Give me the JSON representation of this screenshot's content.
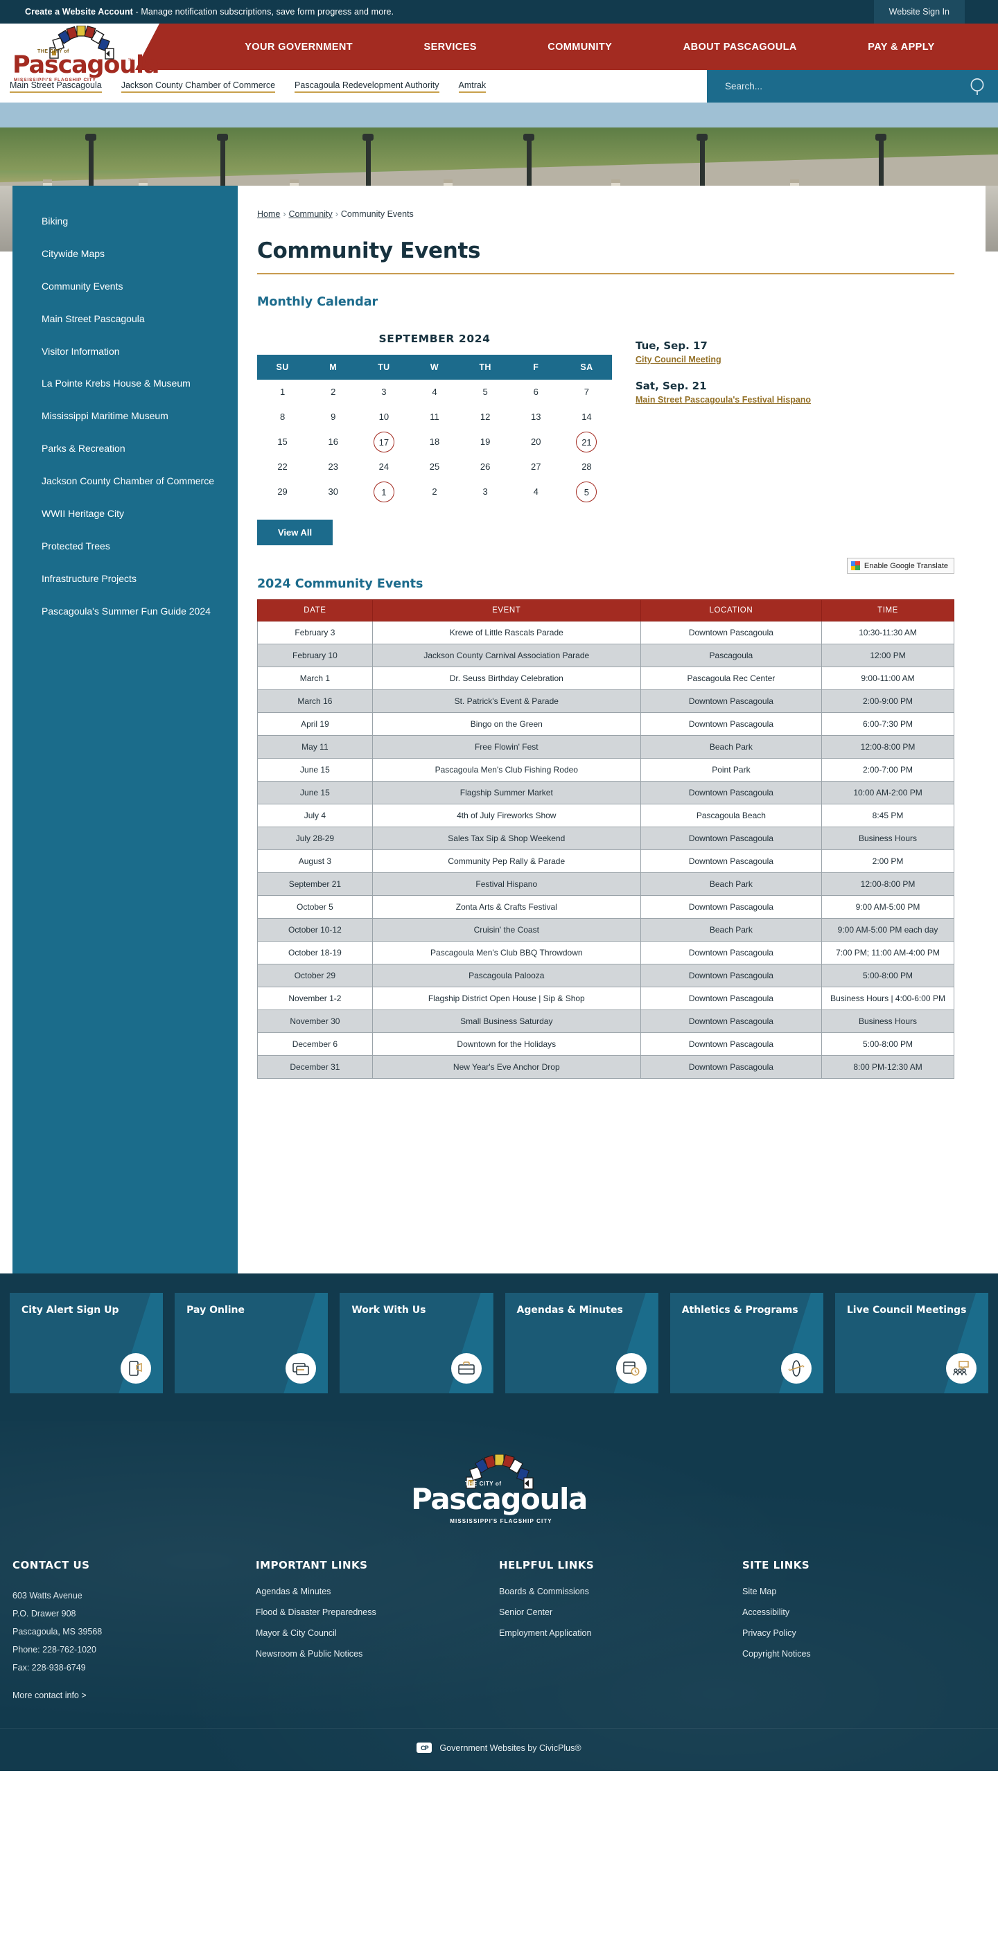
{
  "utility": {
    "account_cta": "Create a Website Account",
    "account_desc": " - Manage notification subscriptions, save form progress and more.",
    "signin_label": "Website Sign In"
  },
  "brand": {
    "name": "Pascagoula",
    "tagline": "THE CITY of",
    "subtitle": "MISSISSIPPI'S FLAGSHIP CITY",
    "tm": "™"
  },
  "main_nav": [
    {
      "label": "YOUR GOVERNMENT"
    },
    {
      "label": "SERVICES"
    },
    {
      "label": "COMMUNITY"
    },
    {
      "label": "ABOUT PASCAGOULA"
    },
    {
      "label": "PAY & APPLY"
    }
  ],
  "sub_nav": [
    {
      "label": "Main Street Pascagoula"
    },
    {
      "label": "Jackson County Chamber of Commerce"
    },
    {
      "label": "Pascagoula Redevelopment Authority"
    },
    {
      "label": "Amtrak"
    }
  ],
  "search": {
    "placeholder": "Search...",
    "value": ""
  },
  "sidebar": {
    "items": [
      {
        "label": "Biking"
      },
      {
        "label": "Citywide Maps"
      },
      {
        "label": "Community Events"
      },
      {
        "label": "Main Street Pascagoula"
      },
      {
        "label": "Visitor Information"
      },
      {
        "label": "La Pointe Krebs House & Museum"
      },
      {
        "label": "Mississippi Maritime Museum"
      },
      {
        "label": "Parks & Recreation"
      },
      {
        "label": "Jackson County Chamber of Commerce"
      },
      {
        "label": "WWII Heritage City"
      },
      {
        "label": "Protected Trees"
      },
      {
        "label": "Infrastructure Projects"
      },
      {
        "label": "Pascagoula's Summer Fun Guide 2024"
      }
    ]
  },
  "breadcrumb": {
    "home": "Home",
    "parent": "Community",
    "current": "Community Events",
    "separator": "›"
  },
  "page": {
    "title": "Community Events",
    "calendar_heading": "Monthly Calendar",
    "events_table_heading": "2024 Community Events",
    "view_all_label": "View All"
  },
  "translate": {
    "label": "Enable Google Translate"
  },
  "calendar": {
    "month_label": "SEPTEMBER 2024",
    "weekdays": [
      "SU",
      "M",
      "TU",
      "W",
      "TH",
      "F",
      "SA"
    ],
    "weeks": [
      [
        {
          "d": "1"
        },
        {
          "d": "2"
        },
        {
          "d": "3"
        },
        {
          "d": "4"
        },
        {
          "d": "5"
        },
        {
          "d": "6"
        },
        {
          "d": "7"
        }
      ],
      [
        {
          "d": "8"
        },
        {
          "d": "9"
        },
        {
          "d": "10"
        },
        {
          "d": "11"
        },
        {
          "d": "12"
        },
        {
          "d": "13"
        },
        {
          "d": "14"
        }
      ],
      [
        {
          "d": "15"
        },
        {
          "d": "16"
        },
        {
          "d": "17",
          "marked": true
        },
        {
          "d": "18"
        },
        {
          "d": "19"
        },
        {
          "d": "20"
        },
        {
          "d": "21",
          "marked": true
        }
      ],
      [
        {
          "d": "22"
        },
        {
          "d": "23"
        },
        {
          "d": "24"
        },
        {
          "d": "25"
        },
        {
          "d": "26"
        },
        {
          "d": "27"
        },
        {
          "d": "28"
        }
      ],
      [
        {
          "d": "29"
        },
        {
          "d": "30"
        },
        {
          "d": "1",
          "marked": true
        },
        {
          "d": "2"
        },
        {
          "d": "3"
        },
        {
          "d": "4"
        },
        {
          "d": "5",
          "marked": true
        }
      ]
    ]
  },
  "upcoming_events": [
    {
      "date": "Tue, Sep. 17",
      "title": "City Council Meeting"
    },
    {
      "date": "Sat, Sep. 21",
      "title": "Main Street Pascagoula's Festival Hispano"
    }
  ],
  "events_table": {
    "columns": [
      "DATE",
      "EVENT",
      "LOCATION",
      "TIME"
    ],
    "rows": [
      [
        "February 3",
        "Krewe of Little Rascals Parade",
        "Downtown Pascagoula",
        "10:30-11:30 AM"
      ],
      [
        "February 10",
        "Jackson County Carnival Association Parade",
        "Pascagoula",
        "12:00 PM"
      ],
      [
        "March 1",
        "Dr. Seuss Birthday Celebration",
        "Pascagoula Rec Center",
        "9:00-11:00 AM"
      ],
      [
        "March 16",
        "St. Patrick's Event & Parade",
        "Downtown Pascagoula",
        "2:00-9:00 PM"
      ],
      [
        "April 19",
        "Bingo on the Green",
        "Downtown Pascagoula",
        "6:00-7:30 PM"
      ],
      [
        "May 11",
        "Free Flowin' Fest",
        "Beach Park",
        "12:00-8:00 PM"
      ],
      [
        "June 15",
        "Pascagoula Men's Club Fishing Rodeo",
        "Point Park",
        "2:00-7:00 PM"
      ],
      [
        "June 15",
        "Flagship Summer Market",
        "Downtown Pascagoula",
        "10:00 AM-2:00 PM"
      ],
      [
        "July 4",
        "4th of July Fireworks Show",
        "Pascagoula Beach",
        "8:45 PM"
      ],
      [
        "July 28-29",
        "Sales Tax Sip & Shop Weekend",
        "Downtown Pascagoula",
        "Business Hours"
      ],
      [
        "August 3",
        "Community Pep Rally & Parade",
        "Downtown Pascagoula",
        "2:00 PM"
      ],
      [
        "September 21",
        "Festival Hispano",
        "Beach Park",
        "12:00-8:00 PM"
      ],
      [
        "October 5",
        "Zonta Arts & Crafts Festival",
        "Downtown Pascagoula",
        "9:00 AM-5:00 PM"
      ],
      [
        "October 10-12",
        "Cruisin' the Coast",
        "Beach Park",
        "9:00 AM-5:00 PM each day"
      ],
      [
        "October 18-19",
        "Pascagoula Men's Club BBQ Throwdown",
        "Downtown Pascagoula",
        "7:00 PM; 11:00 AM-4:00 PM"
      ],
      [
        "October 29",
        "Pascagoula Palooza",
        "Downtown Pascagoula",
        "5:00-8:00 PM"
      ],
      [
        "November 1-2",
        "Flagship District Open House | Sip & Shop",
        "Downtown Pascagoula",
        "Business Hours | 4:00-6:00 PM"
      ],
      [
        "November 30",
        "Small Business Saturday",
        "Downtown Pascagoula",
        "Business Hours"
      ],
      [
        "December 6",
        "Downtown for the Holidays",
        "Downtown Pascagoula",
        "5:00-8:00 PM"
      ],
      [
        "December 31",
        "New Year's Eve Anchor Drop",
        "Downtown Pascagoula",
        "8:00 PM-12:30 AM"
      ]
    ]
  },
  "quick_cards": [
    {
      "label": "City Alert Sign Up",
      "icon": "phone-megaphone-icon"
    },
    {
      "label": "Pay Online",
      "icon": "credit-card-icon"
    },
    {
      "label": "Work With Us",
      "icon": "briefcase-icon"
    },
    {
      "label": "Agendas & Minutes",
      "icon": "calendar-clock-icon"
    },
    {
      "label": "Athletics & Programs",
      "icon": "kayak-icon"
    },
    {
      "label": "Live Council Meetings",
      "icon": "speech-people-icon"
    }
  ],
  "footer": {
    "contact": {
      "heading": "CONTACT US",
      "lines": [
        "603 Watts Avenue",
        "P.O. Drawer 908",
        "Pascagoula, MS 39568",
        "Phone: 228-762-1020",
        "Fax: 228-938-6749"
      ],
      "more_link": "More contact info >"
    },
    "important": {
      "heading": "IMPORTANT LINKS",
      "links": [
        "Agendas & Minutes",
        "Flood & Disaster Preparedness",
        "Mayor & City Council",
        "Newsroom & Public Notices"
      ]
    },
    "helpful": {
      "heading": "HELPFUL LINKS",
      "links": [
        "Boards & Commissions",
        "Senior Center",
        "Employment Application"
      ]
    },
    "site": {
      "heading": "SITE LINKS",
      "links": [
        "Site Map",
        "Accessibility",
        "Privacy Policy",
        "Copyright Notices"
      ]
    },
    "credit": "Government Websites by CivicPlus®",
    "credit_badge": "CP"
  }
}
